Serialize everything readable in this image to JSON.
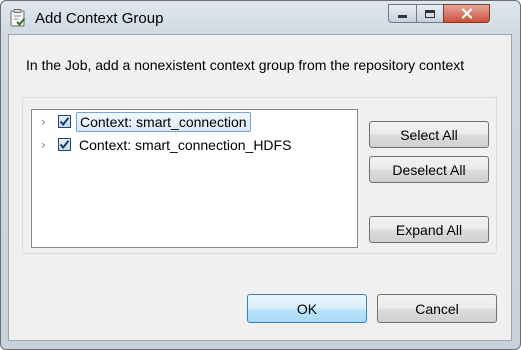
{
  "window": {
    "title": "Add Context Group",
    "icon": "clipboard-check-icon"
  },
  "instruction": "In the Job, add a nonexistent context group from the repository context",
  "tree": {
    "items": [
      {
        "label": "Context: smart_connection",
        "checked": true,
        "selected": true,
        "expanded": false
      },
      {
        "label": "Context: smart_connection_HDFS",
        "checked": true,
        "selected": false,
        "expanded": false
      }
    ]
  },
  "buttons": {
    "select_all": "Select All",
    "deselect_all": "Deselect All",
    "expand_all": "Expand All",
    "ok": "OK",
    "cancel": "Cancel"
  },
  "colors": {
    "selection_fill": "#d8e8f8",
    "selection_border": "#7da2ce",
    "default_button_border": "#3c7fb1",
    "close_button": "#c9503d"
  }
}
